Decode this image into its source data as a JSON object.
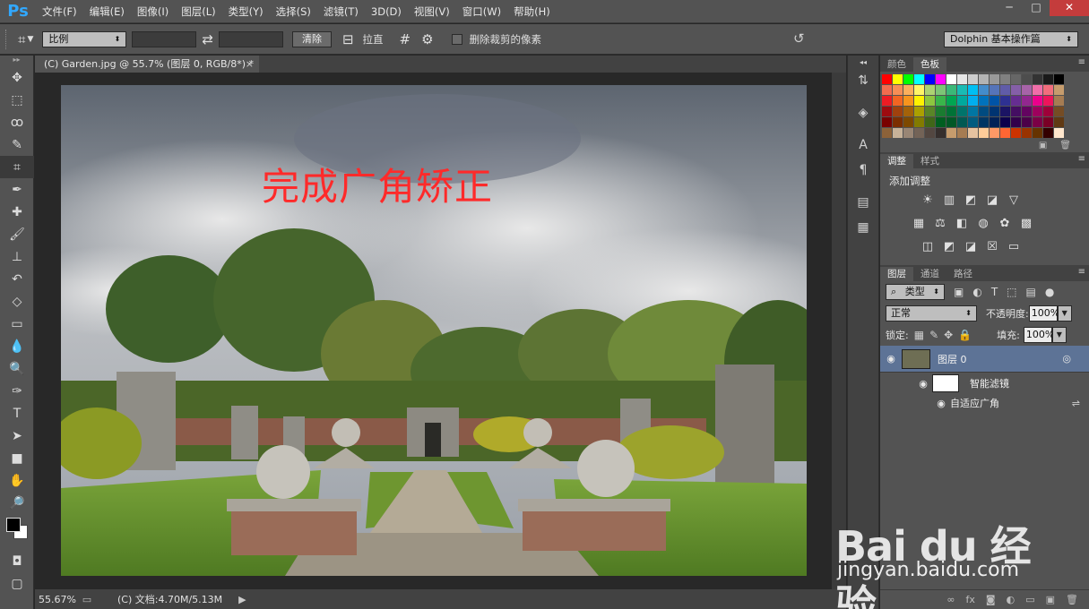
{
  "app": {
    "logo": "Ps"
  },
  "menu": [
    "文件(F)",
    "编辑(E)",
    "图像(I)",
    "图层(L)",
    "类型(Y)",
    "选择(S)",
    "滤镜(T)",
    "3D(D)",
    "视图(V)",
    "窗口(W)",
    "帮助(H)"
  ],
  "window_controls": {
    "minimize": "─",
    "restore": "□",
    "close": "✕"
  },
  "options": {
    "ratio_select": "比例",
    "swap_icon": "⇄",
    "clear_button": "清除",
    "straighten_label": "拉直",
    "delete_cropped_label": "删除裁剪的像素",
    "workspace": "Dolphin 基本操作篇"
  },
  "document": {
    "tab_title": "(C) Garden.jpg @ 55.7% (图层 0, RGB/8*) *",
    "overlay_text": "完成广角矫正"
  },
  "status": {
    "zoom": "55.67%",
    "doc_info": "(C) 文档:4.70M/5.13M"
  },
  "panels": {
    "color_tabs": [
      "颜色",
      "色板"
    ],
    "swatch_colors": [
      "#ff0000",
      "#ffff00",
      "#00ff00",
      "#00ffff",
      "#0000ff",
      "#ff00ff",
      "#ffffff",
      "#e6e6e6",
      "#cccccc",
      "#b3b3b3",
      "#999999",
      "#808080",
      "#666666",
      "#4d4d4d",
      "#333333",
      "#1a1a1a",
      "#000000",
      "#f26c4f",
      "#f68e56",
      "#fbaf5d",
      "#fff467",
      "#acd372",
      "#7cc576",
      "#3bb878",
      "#1abbb4",
      "#00bff3",
      "#438ccb",
      "#5574b9",
      "#605ca8",
      "#855fa8",
      "#a763a8",
      "#f06ea9",
      "#f26d7d",
      "#c69c6d",
      "#ed1c24",
      "#f26522",
      "#f7941d",
      "#fff200",
      "#8dc63f",
      "#39b54a",
      "#00a651",
      "#00a99d",
      "#00aeef",
      "#0072bc",
      "#0054a6",
      "#2e3192",
      "#662d91",
      "#92278f",
      "#ec008c",
      "#ed145b",
      "#a67c52",
      "#9e0b0f",
      "#a0410d",
      "#a36209",
      "#aba000",
      "#598527",
      "#1a7b30",
      "#007236",
      "#00746b",
      "#0076a3",
      "#004b80",
      "#003471",
      "#1b1464",
      "#440e62",
      "#630460",
      "#9e005d",
      "#9e0039",
      "#754c24",
      "#790000",
      "#7b2e00",
      "#7d4900",
      "#827b00",
      "#406618",
      "#005e20",
      "#005826",
      "#005952",
      "#005b7f",
      "#003663",
      "#002157",
      "#0d004c",
      "#32004b",
      "#4b0049",
      "#7b0046",
      "#7a0026",
      "#603913",
      "#8c6239",
      "#c7b299",
      "#998675",
      "#736357",
      "#534741",
      "#362f2d",
      "#c69c6d",
      "#a67c52",
      "#e6c3a0",
      "#ffcc99",
      "#ff9966",
      "#ff6633",
      "#cc3300",
      "#993300",
      "#663300",
      "#330000",
      "#ffe6cc"
    ],
    "adjust_tabs": [
      "调整",
      "样式"
    ],
    "adjust_title": "添加调整",
    "adjust_rows": [
      [
        "☀",
        "▥",
        "◩",
        "◪",
        "▽"
      ],
      [
        "▦",
        "⚖",
        "◧",
        "◍",
        "✿",
        "▩"
      ],
      [
        "◫",
        "◩",
        "◪",
        "☒",
        "▭"
      ]
    ],
    "layers_tabs": [
      "图层",
      "通道",
      "路径"
    ],
    "filter_kind": "类型",
    "blend_mode": "正常",
    "opacity_label": "不透明度:",
    "opacity_value": "100%",
    "lock_label": "锁定:",
    "fill_label": "填充:",
    "fill_value": "100%",
    "layer_name": "图层 0",
    "smart_filter_label": "智能滤镜",
    "filter_name": "自适应广角",
    "footer_icons": [
      "∞",
      "fx",
      "◙",
      "◐",
      "▭",
      "▣",
      "🗑"
    ]
  },
  "watermark": {
    "text": "Bai du 经验",
    "url": "jingyan.baidu.com"
  }
}
